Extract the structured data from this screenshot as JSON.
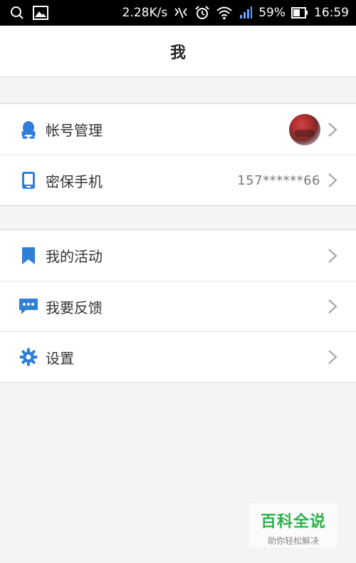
{
  "status_bar": {
    "network_speed": "2.28K/s",
    "battery": "59%",
    "time": "16:59",
    "icons": [
      "search-icon",
      "gallery-icon",
      "vibrate-icon",
      "alarm-icon",
      "wifi-icon",
      "signal-icon",
      "battery-icon"
    ]
  },
  "header": {
    "title": "我"
  },
  "account_group": [
    {
      "label": "帐号管理",
      "icon": "qq-penguin-icon"
    },
    {
      "label": "密保手机",
      "value": "157******66",
      "icon": "phone-icon"
    }
  ],
  "menu_group": [
    {
      "label": "我的活动",
      "icon": "bookmark-icon"
    },
    {
      "label": "我要反馈",
      "icon": "chat-bubble-icon"
    },
    {
      "label": "设置",
      "icon": "gear-icon"
    }
  ],
  "watermark": {
    "title": "百科全说",
    "subtitle": "助你轻松解决"
  },
  "colors": {
    "accent": "#2f7fd6",
    "watermark_green": "#2bb14a"
  }
}
